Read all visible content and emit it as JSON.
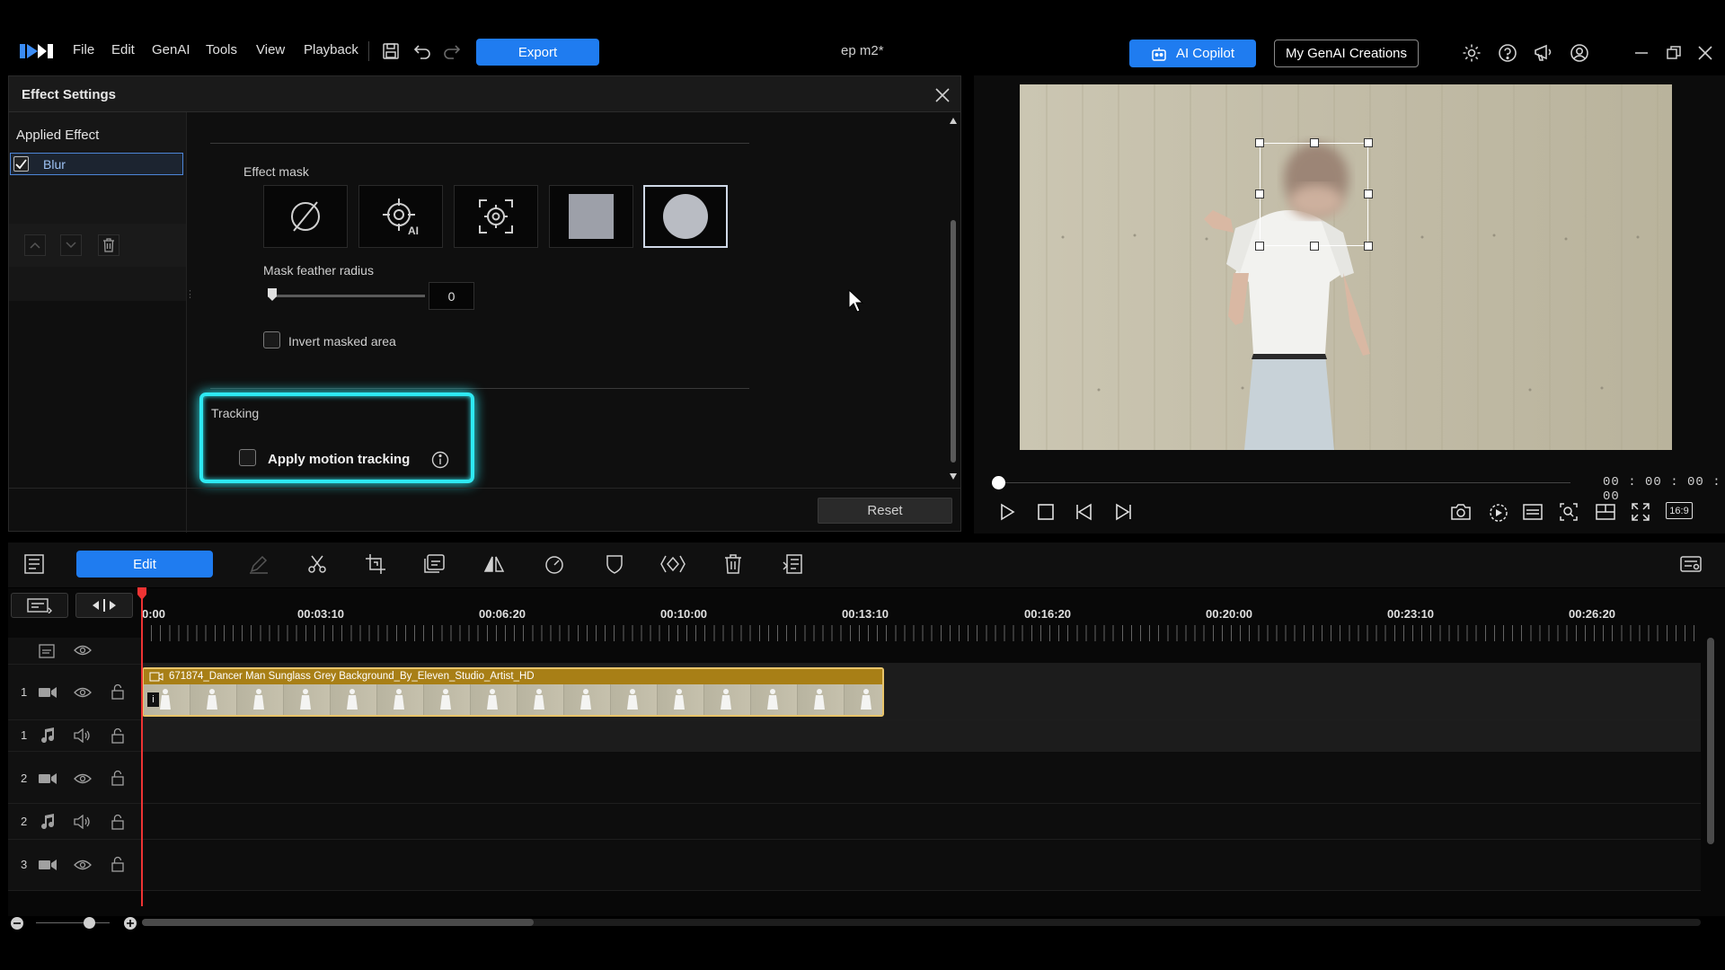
{
  "menu": {
    "file": "File",
    "edit": "Edit",
    "genai": "GenAI",
    "tools": "Tools",
    "view": "View",
    "playback": "Playback"
  },
  "toolbar": {
    "export_label": "Export",
    "project_title": "ep m2*",
    "ai_copilot_label": "AI Copilot",
    "my_genai_label": "My GenAI Creations"
  },
  "effect_settings": {
    "title": "Effect Settings",
    "applied_effect_title": "Applied Effect",
    "applied_effects": [
      {
        "label": "Blur",
        "checked": true
      }
    ],
    "effect_mask_label": "Effect mask",
    "mask_options": [
      "none",
      "ai-subject",
      "tracking-target",
      "rectangle",
      "ellipse"
    ],
    "selected_mask": "ellipse",
    "mask_feather_label": "Mask feather radius",
    "mask_feather_value": "0",
    "invert_label": "Invert masked area",
    "invert_checked": false,
    "tracking_label": "Tracking",
    "motion_tracking_label": "Apply motion tracking",
    "motion_tracking_checked": false,
    "reset_label": "Reset"
  },
  "preview": {
    "timecode": "00 : 00 : 00 : 00",
    "aspect_label": "16:9",
    "playback_progress": 0
  },
  "timeline": {
    "edit_label": "Edit",
    "ruler_labels": [
      "0:00",
      "00:03:10",
      "00:06:20",
      "00:10:00",
      "00:13:10",
      "00:16:20",
      "00:20:00",
      "00:23:10",
      "00:26:20"
    ],
    "tracks": [
      {
        "num": "1",
        "type": "video"
      },
      {
        "num": "1",
        "type": "audio"
      },
      {
        "num": "2",
        "type": "video"
      },
      {
        "num": "2",
        "type": "audio"
      },
      {
        "num": "3",
        "type": "video"
      }
    ],
    "clip_title": "671874_Dancer Man Sunglass Grey Background_By_Eleven_Studio_Artist_HD"
  },
  "colors": {
    "accent": "#1f7cf0",
    "highlight": "#2ee9f2",
    "clip_border": "#e8c46a"
  }
}
